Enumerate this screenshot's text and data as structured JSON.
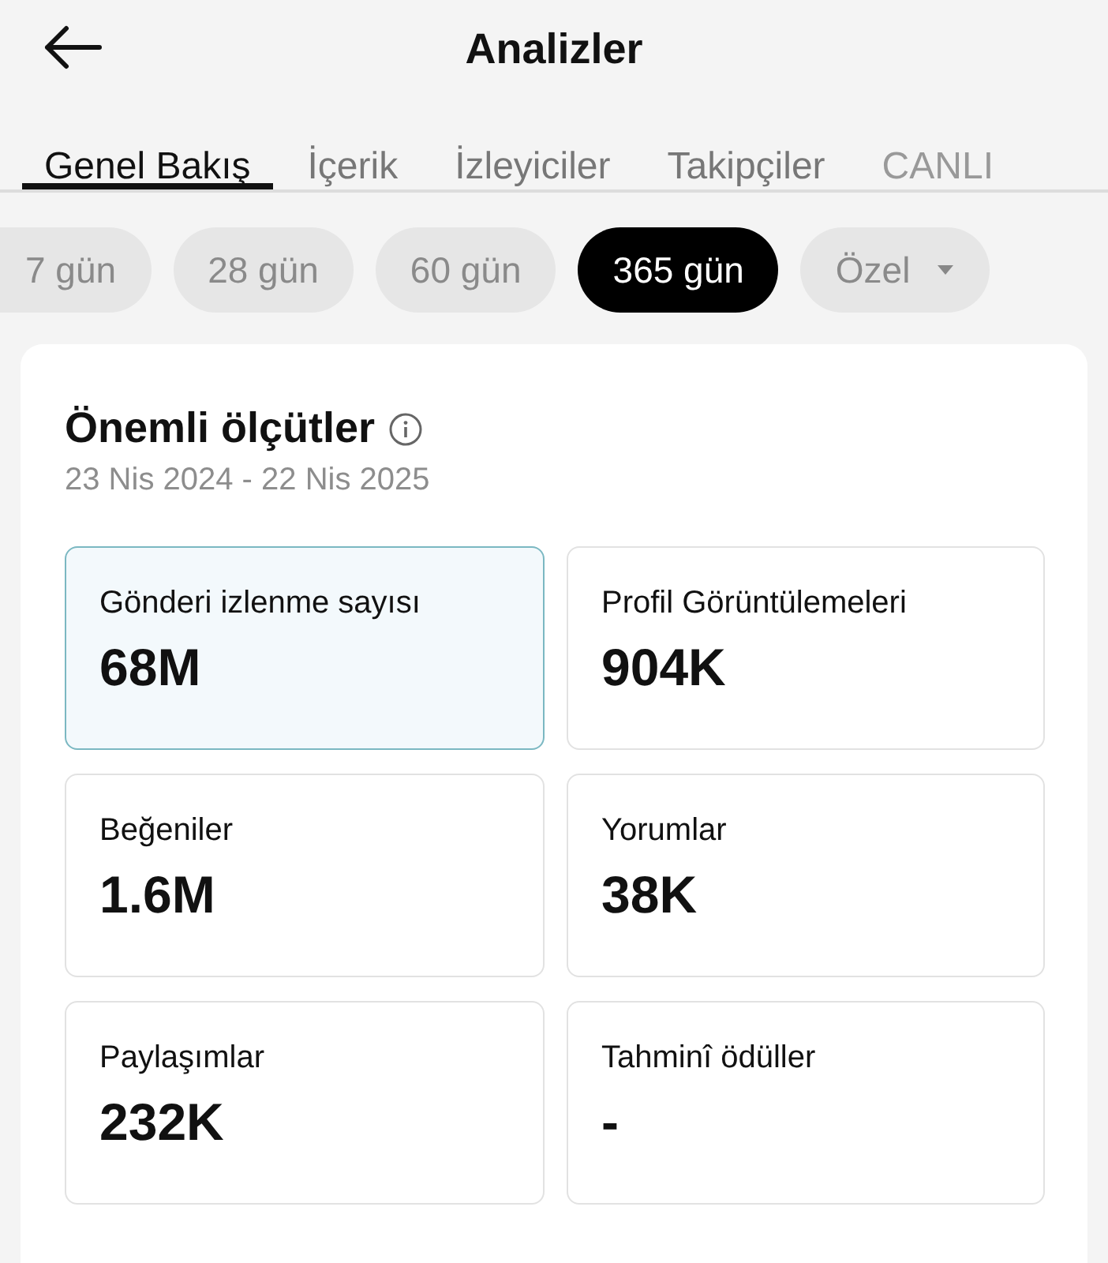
{
  "header": {
    "title": "Analizler"
  },
  "tabs": [
    {
      "label": "Genel Bakış",
      "selected": true
    },
    {
      "label": "İçerik",
      "selected": false
    },
    {
      "label": "İzleyiciler",
      "selected": false
    },
    {
      "label": "Takipçiler",
      "selected": false
    },
    {
      "label": "CANLI",
      "selected": false
    }
  ],
  "periods": [
    {
      "label": "7 gün",
      "selected": false,
      "kind": "plain"
    },
    {
      "label": "28 gün",
      "selected": false,
      "kind": "plain"
    },
    {
      "label": "60 gün",
      "selected": false,
      "kind": "plain"
    },
    {
      "label": "365 gün",
      "selected": true,
      "kind": "plain"
    },
    {
      "label": "Özel",
      "selected": false,
      "kind": "dropdown"
    }
  ],
  "metrics_card": {
    "title": "Önemli ölçütler",
    "date_range": "23 Nis 2024 - 22 Nis 2025",
    "metrics": [
      {
        "label": "Gönderi izlenme sayısı",
        "value": "68M",
        "selected": true
      },
      {
        "label": "Profil Görüntülemeleri",
        "value": "904K",
        "selected": false
      },
      {
        "label": "Beğeniler",
        "value": "1.6M",
        "selected": false
      },
      {
        "label": "Yorumlar",
        "value": "38K",
        "selected": false
      },
      {
        "label": "Paylaşımlar",
        "value": "232K",
        "selected": false
      },
      {
        "label": "Tahminî ödüller",
        "value": "-",
        "selected": false
      }
    ]
  }
}
